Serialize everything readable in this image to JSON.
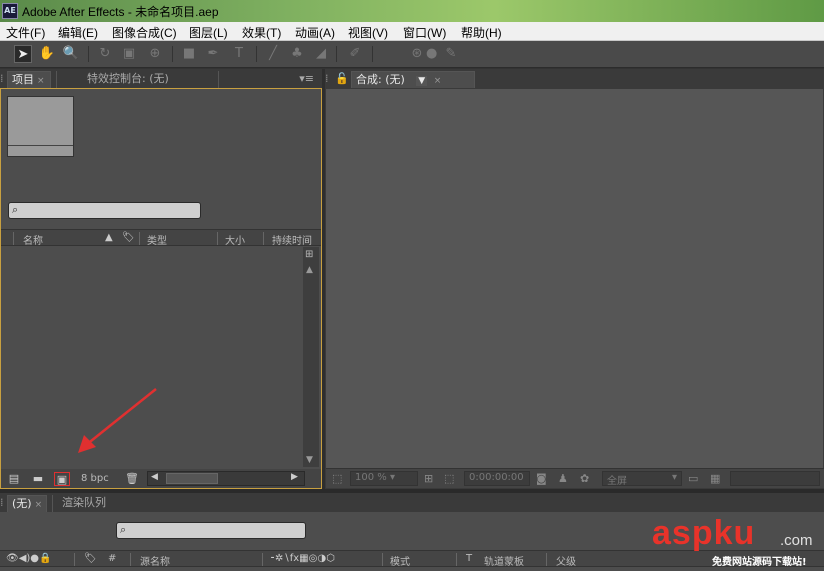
{
  "window": {
    "title": "Adobe After Effects - 未命名项目.aep",
    "app_icon": "AE"
  },
  "menu": [
    "文件(F)",
    "编辑(E)",
    "图像合成(C)",
    "图层(L)",
    "效果(T)",
    "动画(A)",
    "视图(V)",
    "窗口(W)",
    "帮助(H)"
  ],
  "tools": [
    "selection-tool-icon",
    "hand-tool-icon",
    "zoom-tool-icon",
    "rotate-tool-icon",
    "camera-tool-icon",
    "pan-behind-tool-icon",
    "rectangle-tool-icon",
    "pen-tool-icon",
    "type-tool-icon",
    "brush-tool-icon",
    "clone-stamp-tool-icon",
    "eraser-tool-icon",
    "roto-brush-tool-icon",
    "puppet-pin-tool-icon"
  ],
  "project_panel": {
    "tab_label": "项目",
    "effects_tab_label": "特效控制台: (无)",
    "columns": [
      "名称",
      "类型",
      "大小",
      "持续时间"
    ],
    "bpc_label": "8 bpc"
  },
  "comp_panel": {
    "tab_label": "合成: (无)",
    "zoom": "100 %",
    "timecode": "0:00:00:00",
    "resolution": "全屏"
  },
  "timeline_panel": {
    "tab_label": "(无)",
    "render_tab_label": "渲染队列",
    "columns": [
      "#",
      "源名称",
      "模式",
      "T",
      "轨道蒙板",
      "父级"
    ]
  },
  "watermark": {
    "brand": "aspku",
    "suffix": ".com",
    "tagline": "免费网站源码下载站!"
  },
  "colors": {
    "panel_border_active": "#c8a040",
    "accent_red": "#e03030",
    "watermark_red": "#e8332a"
  }
}
